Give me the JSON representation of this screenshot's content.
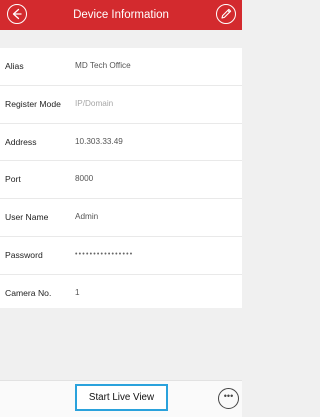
{
  "header": {
    "title": "Device Information",
    "back_icon": "back-arrow-icon",
    "edit_icon": "pencil-icon",
    "color": "#d32a2e"
  },
  "fields": [
    {
      "label": "Alias",
      "value": "MD Tech Office",
      "state": "filled"
    },
    {
      "label": "Register Mode",
      "value": "IP/Domain",
      "state": "muted"
    },
    {
      "label": "Address",
      "value": "10.303.33.49",
      "state": "filled"
    },
    {
      "label": "Port",
      "value": "8000",
      "state": "filled"
    },
    {
      "label": "User Name",
      "value": "Admin",
      "state": "filled"
    },
    {
      "label": "Password",
      "value": "••••••••••••••••",
      "state": "masked"
    },
    {
      "label": "Camera No.",
      "value": "1",
      "state": "filled"
    }
  ],
  "footer": {
    "start_live_view_label": "Start Live View",
    "more_label": "•••",
    "accent": "#2aa2dc"
  }
}
